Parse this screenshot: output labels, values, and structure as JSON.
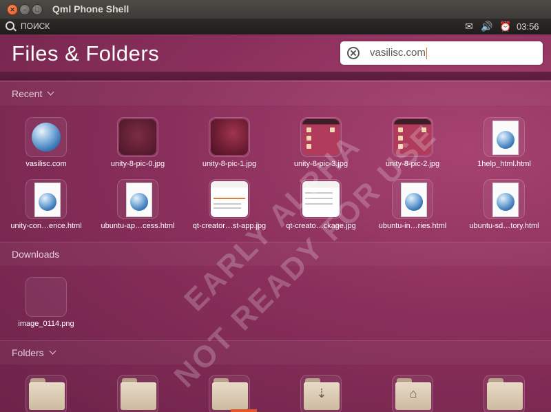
{
  "window": {
    "title": "Qml Phone Shell"
  },
  "panel": {
    "search_label": "ПОИСК",
    "clock": "03:56"
  },
  "dash": {
    "title": "Files & Folders",
    "search": {
      "value": "vasilisc.com"
    },
    "watermark": {
      "line1": "EARLY ALPHA",
      "line2": "NOT READY FOR USE"
    }
  },
  "sections": {
    "recent": {
      "label": "Recent",
      "items": [
        {
          "label": "vasilisc.com",
          "icon": "globe-icon"
        },
        {
          "label": "unity-8-pic-0.jpg",
          "icon": "image-thumbnail"
        },
        {
          "label": "unity-8-pic-1.jpg",
          "icon": "image-thumbnail"
        },
        {
          "label": "unity-8-pic-3.jpg",
          "icon": "image-thumbnail"
        },
        {
          "label": "unity-8-pic-2.jpg",
          "icon": "image-thumbnail"
        },
        {
          "label": "1help_html.html",
          "icon": "html-document-icon"
        },
        {
          "label": "unity-con…ence.html",
          "icon": "html-document-icon"
        },
        {
          "label": "ubuntu-ap…cess.html",
          "icon": "html-document-icon"
        },
        {
          "label": "qt-creator…st-app.jpg",
          "icon": "image-thumbnail"
        },
        {
          "label": "qt-creato…ckage.jpg",
          "icon": "image-thumbnail"
        },
        {
          "label": "ubuntu-in…ries.html",
          "icon": "html-document-icon"
        },
        {
          "label": "ubuntu-sd…tory.html",
          "icon": "html-document-icon"
        }
      ]
    },
    "downloads": {
      "label": "Downloads",
      "items": [
        {
          "label": "image_0114.png",
          "icon": "image-thumbnail"
        }
      ]
    },
    "folders": {
      "label": "Folders",
      "icons": [
        "folder-icon",
        "folder-icon",
        "folder-icon",
        "downloads-folder-icon",
        "home-folder-icon",
        "folder-icon"
      ]
    }
  },
  "colors": {
    "accent": "#e0572b",
    "background": "#8a2f5b"
  }
}
